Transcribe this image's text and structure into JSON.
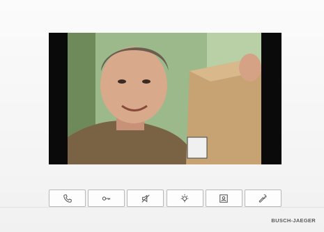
{
  "device": {
    "brand": "BUSCH-JAEGER"
  },
  "screen": {
    "video_feed": "visitor-camera-feed"
  },
  "buttons": [
    {
      "icon": "phone-icon"
    },
    {
      "icon": "key-icon"
    },
    {
      "icon": "mute-icon"
    },
    {
      "icon": "light-icon"
    },
    {
      "icon": "contact-card-icon"
    },
    {
      "icon": "wrench-icon"
    }
  ]
}
